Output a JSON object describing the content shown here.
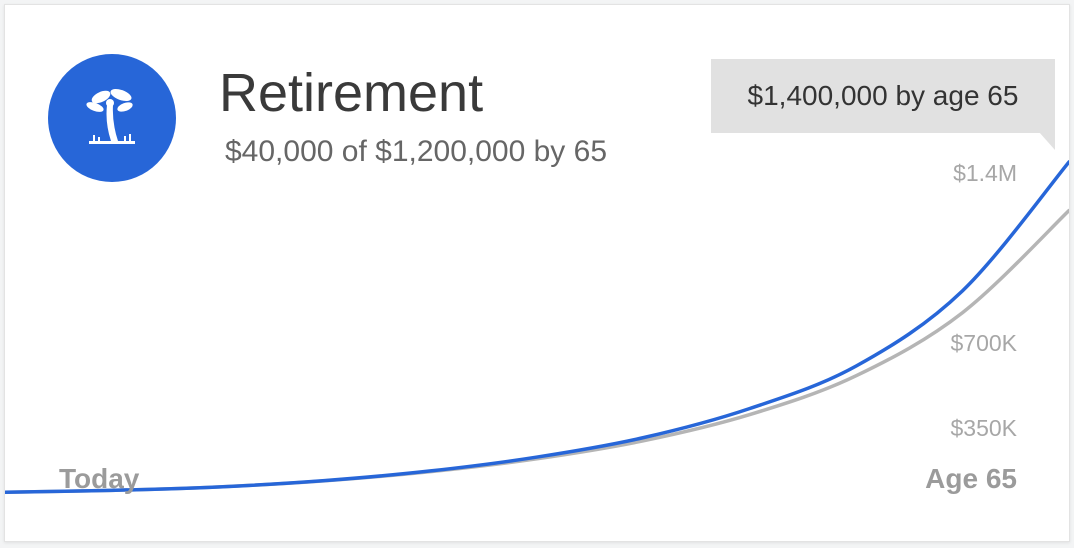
{
  "goal": {
    "icon": "palm-tree-icon",
    "title": "Retirement",
    "subtitle": "$40,000 of $1,200,000 by 65",
    "projection_label": "$1,400,000 by age 65"
  },
  "colors": {
    "accent": "#2766d8",
    "target_line": "#b5b5b5",
    "badge_bg": "#e1e1e1",
    "axis_text": "#a7a7a7"
  },
  "chart_data": {
    "type": "line",
    "title": "",
    "xlabel": "",
    "ylabel": "",
    "x_labels": [
      "Today",
      "Age 65"
    ],
    "y_ticks": [
      {
        "value": 350000,
        "label": "$350K"
      },
      {
        "value": 700000,
        "label": "$700K"
      },
      {
        "value": 1400000,
        "label": "$1.4M"
      }
    ],
    "ylim": [
      0,
      1400000
    ],
    "grid": false,
    "series": [
      {
        "color": "#2766d8",
        "points": [
          [
            0,
            40000
          ],
          [
            0.1,
            48000
          ],
          [
            0.2,
            62000
          ],
          [
            0.3,
            88000
          ],
          [
            0.4,
            128000
          ],
          [
            0.5,
            185000
          ],
          [
            0.6,
            265000
          ],
          [
            0.7,
            385000
          ],
          [
            0.8,
            560000
          ],
          [
            0.9,
            870000
          ],
          [
            1.0,
            1400000
          ]
        ]
      },
      {
        "color": "#b5b5b5",
        "points": [
          [
            0,
            40000
          ],
          [
            0.1,
            48000
          ],
          [
            0.2,
            62000
          ],
          [
            0.3,
            87000
          ],
          [
            0.4,
            125000
          ],
          [
            0.5,
            178000
          ],
          [
            0.6,
            252000
          ],
          [
            0.7,
            360000
          ],
          [
            0.8,
            520000
          ],
          [
            0.9,
            780000
          ],
          [
            1.0,
            1200000
          ]
        ]
      }
    ]
  }
}
